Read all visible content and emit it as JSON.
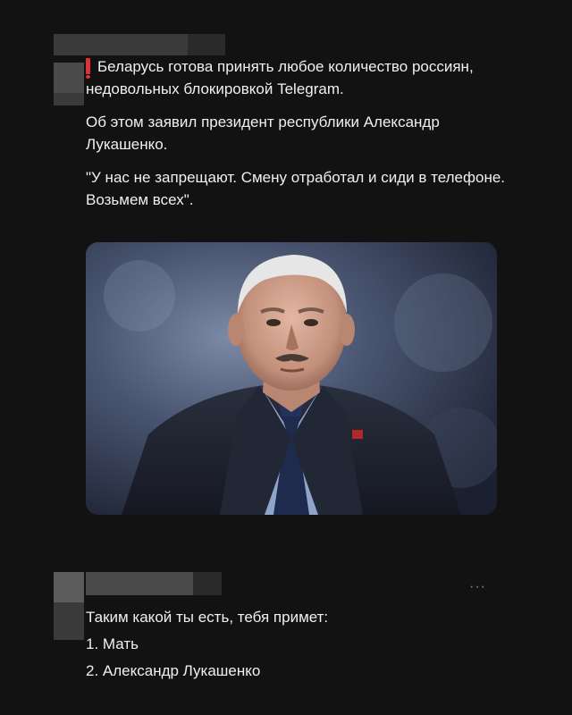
{
  "post1": {
    "headline": "Беларусь готова принять любое количество россиян, недовольных блокировкой Telegram.",
    "paragraph2": "Об этом заявил президент республики Александр Лукашенко.",
    "paragraph3": "\"У нас не запрещают. Смену отработал и сиди в телефоне. Возьмем всех\"."
  },
  "post2": {
    "more_label": "···",
    "line1": "Таким какой ты есть, тебя примет:",
    "line2": "1. Мать",
    "line3": "2. Александр Лукашенко"
  },
  "colors": {
    "background": "#121212",
    "text": "#f0f0f0",
    "alert": "#e0303a",
    "censor": "#3a3a3a"
  }
}
